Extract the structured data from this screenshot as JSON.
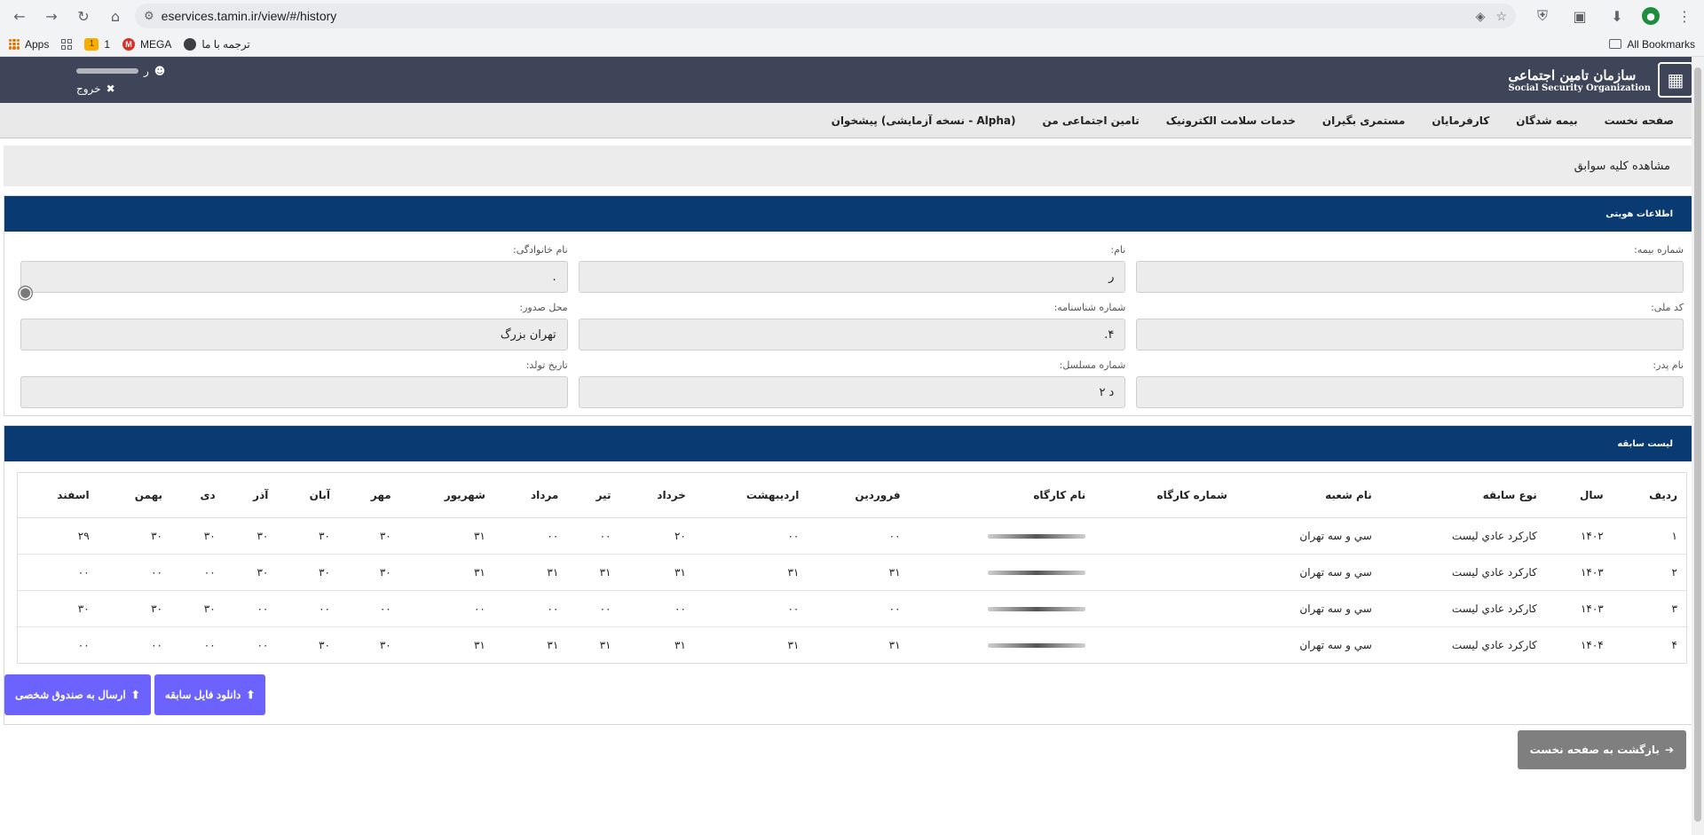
{
  "browser": {
    "url": "eservices.tamin.ir/view/#/history",
    "bookmarks": [
      "Apps",
      "1",
      "MEGA",
      "ترجمه با ما"
    ],
    "all_bookmarks": "All Bookmarks"
  },
  "header": {
    "logo_fa": "سازمان تامین اجتماعی",
    "logo_en": "Social Security Organization",
    "user_initial": "ر",
    "logout": "خروج"
  },
  "menu": [
    "صفحه نخست",
    "بیمه شدگان",
    "کارفرمایان",
    "مستمری بگیران",
    "خدمات سلامت الکترونیک",
    "تامین اجتماعی من",
    "پیشخوان (نسخه آزمایشی - Alpha)"
  ],
  "breadcrumb": "مشاهده کلیه سوابق",
  "identity": {
    "title": "اطلاعات هویتی",
    "fields": [
      {
        "label": "شماره بیمه:",
        "value": ""
      },
      {
        "label": "نام:",
        "value": "ر"
      },
      {
        "label": "نام خانوادگی:",
        "value": "."
      },
      {
        "label": "کد ملی:",
        "value": ""
      },
      {
        "label": "شماره شناسنامه:",
        "value": "۴."
      },
      {
        "label": "محل صدور:",
        "value": "تهران بزرگ"
      },
      {
        "label": "نام پدر:",
        "value": ""
      },
      {
        "label": "شماره مسلسل:",
        "value": "د ۲"
      },
      {
        "label": "تاریخ تولد:",
        "value": ""
      }
    ]
  },
  "history": {
    "title": "لیست سابقه",
    "columns": [
      "ردیف",
      "سال",
      "نوع سابقه",
      "نام شعبه",
      "شماره کارگاه",
      "نام کارگاه",
      "فروردین",
      "اردیبهشت",
      "خرداد",
      "تیر",
      "مرداد",
      "شهریور",
      "مهر",
      "آبان",
      "آذر",
      "دی",
      "بهمن",
      "اسفند"
    ],
    "rows": [
      [
        "۱",
        "۱۴۰۲",
        "کارکرد عادي ليست",
        "سي و سه تهران",
        "",
        "",
        "۰۰",
        "۰۰",
        "۲۰",
        "۰۰",
        "۰۰",
        "۳۱",
        "۳۰",
        "۳۰",
        "۳۰",
        "۳۰",
        "۳۰",
        "۲۹"
      ],
      [
        "۲",
        "۱۴۰۳",
        "کارکرد عادي ليست",
        "سي و سه تهران",
        "",
        "",
        "۳۱",
        "۳۱",
        "۳۱",
        "۳۱",
        "۳۱",
        "۳۱",
        "۳۰",
        "۳۰",
        "۳۰",
        "۰۰",
        "۰۰",
        "۰۰"
      ],
      [
        "۳",
        "۱۴۰۳",
        "کارکرد عادي ليست",
        "سي و سه تهران",
        "",
        "",
        "۰۰",
        "۰۰",
        "۰۰",
        "۰۰",
        "۰۰",
        "۰۰",
        "۰۰",
        "۰۰",
        "۰۰",
        "۳۰",
        "۳۰",
        "۳۰"
      ],
      [
        "۴",
        "۱۴۰۴",
        "کارکرد عادي ليست",
        "سي و سه تهران",
        "",
        "",
        "۳۱",
        "۳۱",
        "۳۱",
        "۳۱",
        "۳۱",
        "۳۱",
        "۳۰",
        "۳۰",
        "۰۰",
        "۰۰",
        "۰۰",
        "۰۰"
      ]
    ]
  },
  "buttons": {
    "download": "دانلود فایل سابقه",
    "send_inbox": "ارسال به صندوق شخصی",
    "back_home": "بازگشت به صفحه نخست"
  }
}
